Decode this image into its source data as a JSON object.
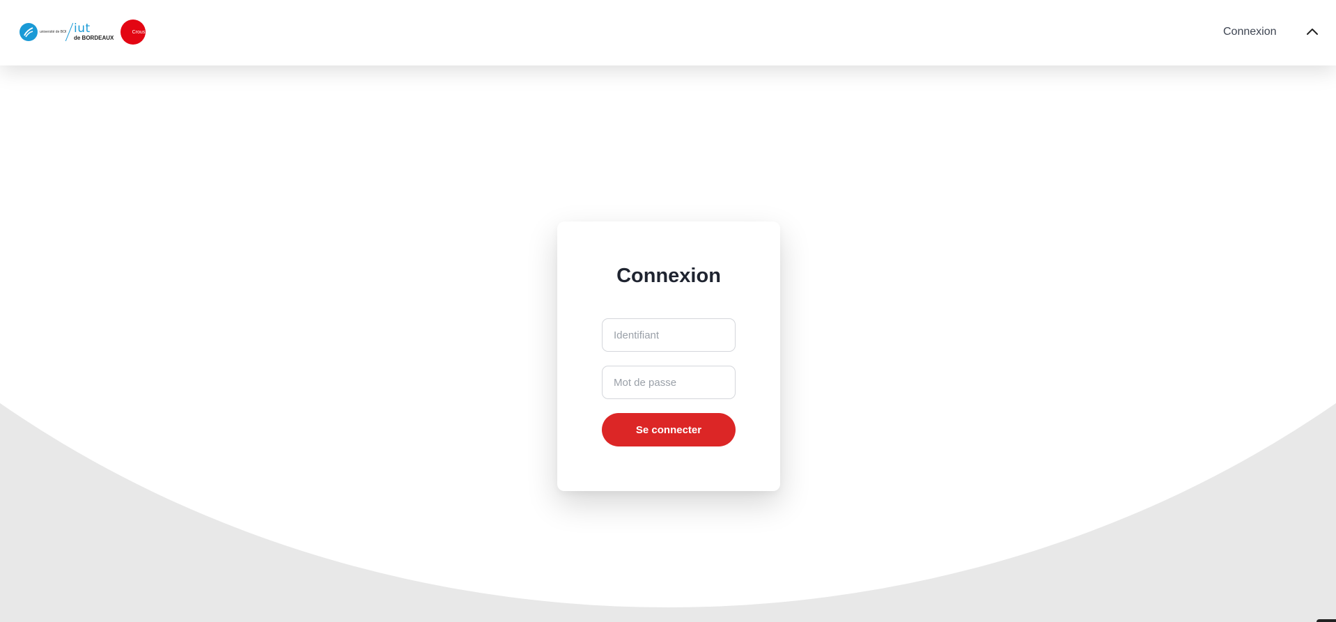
{
  "header": {
    "logos": {
      "ub_text": "université de BORDEAUX",
      "iut_top": "iut",
      "iut_bottom": "de BORDEAUX",
      "crous_text": "Crous"
    },
    "nav_link": "Connexion",
    "toggle_icon": "chevron-up-icon"
  },
  "login": {
    "title": "Connexion",
    "username_placeholder": "Identifiant",
    "username_value": "",
    "password_placeholder": "Mot de passe",
    "password_value": "",
    "submit_label": "Se connecter"
  },
  "colors": {
    "accent": "#dc2626",
    "background_bottom": "#e8e8e8",
    "title": "#1f2430",
    "brand_blue": "#1a9ad6",
    "brand_red": "#e30613"
  }
}
